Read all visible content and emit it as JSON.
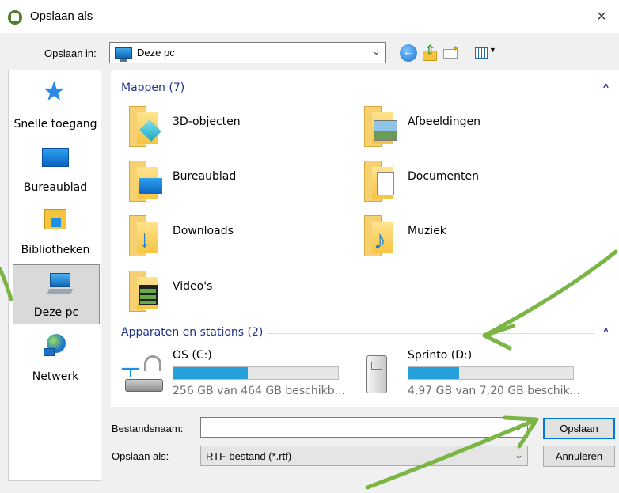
{
  "window": {
    "title": "Opslaan als",
    "close": "×"
  },
  "location": {
    "label": "Opslaan in:",
    "value": "Deze pc"
  },
  "toolbar": {
    "icons": [
      "back-icon",
      "up-folder-icon",
      "new-folder-icon",
      "view-menu-icon"
    ]
  },
  "nav": {
    "items": [
      {
        "label": "Snelle toegang",
        "icon": "star-icon"
      },
      {
        "label": "Bureaublad",
        "icon": "desktop-icon"
      },
      {
        "label": "Bibliotheken",
        "icon": "libraries-icon"
      },
      {
        "label": "Deze pc",
        "icon": "this-pc-icon",
        "selected": true
      },
      {
        "label": "Netwerk",
        "icon": "network-icon"
      }
    ]
  },
  "main": {
    "folders_header": "Mappen (7)",
    "folders": [
      {
        "name": "3D-objecten",
        "icon": "3d-objects-icon"
      },
      {
        "name": "Afbeeldingen",
        "icon": "pictures-icon"
      },
      {
        "name": "Bureaublad",
        "icon": "desktop-folder-icon"
      },
      {
        "name": "Documenten",
        "icon": "documents-icon"
      },
      {
        "name": "Downloads",
        "icon": "downloads-icon"
      },
      {
        "name": "Muziek",
        "icon": "music-icon"
      },
      {
        "name": "Video's",
        "icon": "videos-icon"
      }
    ],
    "drives_header": "Apparaten en stations (2)",
    "drives": [
      {
        "name": "OS (C:)",
        "size": "256 GB van 464 GB beschikb...",
        "used_fraction": 0.45,
        "icon": "system-drive-icon"
      },
      {
        "name": "Sprinto (D:)",
        "size": "4,97 GB van 7,20 GB beschik...",
        "used_fraction": 0.31,
        "icon": "removable-drive-icon"
      }
    ]
  },
  "form": {
    "filename_label": "Bestandsnaam:",
    "filename_value": "",
    "type_label": "Opslaan als:",
    "type_value": "RTF-bestand (*.rtf)",
    "save_label": "Opslaan",
    "cancel_label": "Annuleren"
  },
  "colors": {
    "accent": "#0078d7",
    "group_header": "#1e3287",
    "progress": "#26a0da",
    "annotation": "#7bb543"
  }
}
